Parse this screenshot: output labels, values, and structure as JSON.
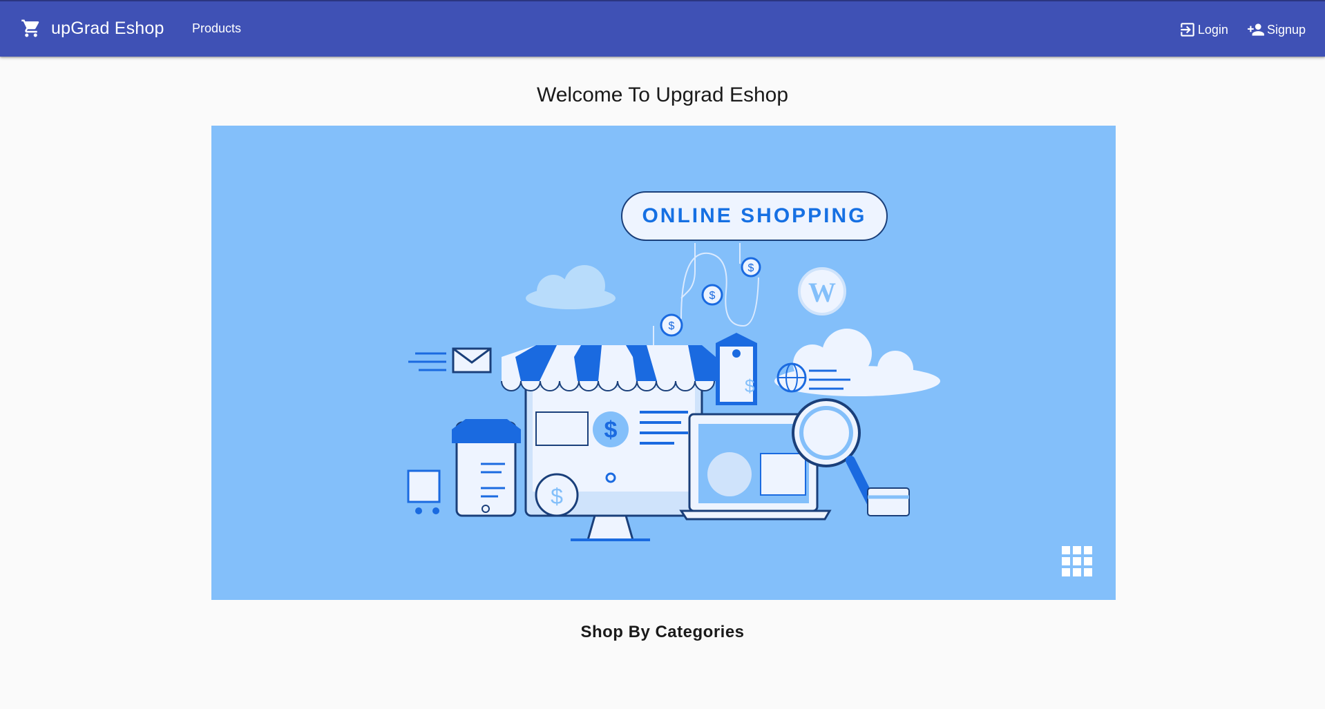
{
  "header": {
    "brand": "upGrad Eshop",
    "nav": {
      "products": "Products",
      "login": "Login",
      "signup": "Signup"
    },
    "color": "#3f51b5"
  },
  "main": {
    "welcome": "Welcome To Upgrad Eshop",
    "banner": {
      "title": "ONLINE SHOPPING",
      "background": "#83bffa"
    },
    "categories_heading": "Shop By Categories"
  }
}
